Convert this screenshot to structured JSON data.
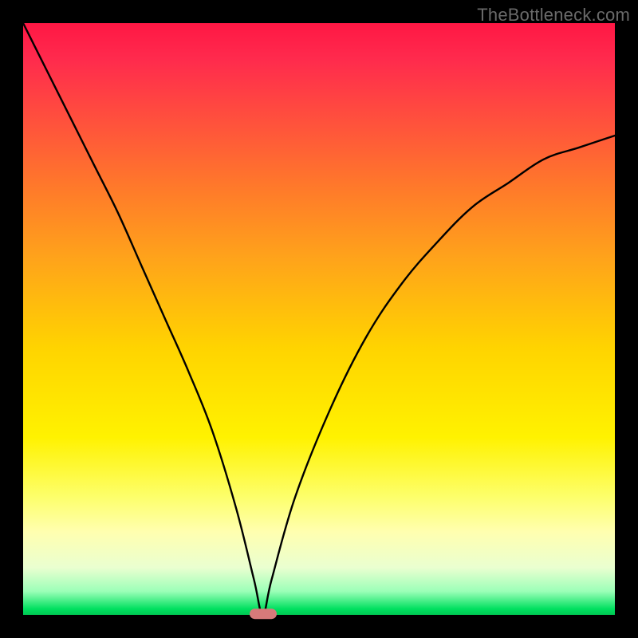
{
  "watermark": {
    "text": "TheBottleneck.com"
  },
  "chart_data": {
    "type": "line",
    "title": "",
    "xlabel": "",
    "ylabel": "",
    "xlim": [
      0,
      100
    ],
    "ylim": [
      0,
      100
    ],
    "optimum_x": 40.5,
    "marker": {
      "x": 40.5,
      "color": "#d77a7a"
    },
    "background_gradient": [
      {
        "stop": 0,
        "color": "#ff1744"
      },
      {
        "stop": 15,
        "color": "#ff4b3f"
      },
      {
        "stop": 40,
        "color": "#ffa41a"
      },
      {
        "stop": 70,
        "color": "#fff200"
      },
      {
        "stop": 92,
        "color": "#eaffd0"
      },
      {
        "stop": 100,
        "color": "#00c853"
      }
    ],
    "series": [
      {
        "name": "bottleneck-curve",
        "x": [
          0,
          4,
          8,
          12,
          16,
          20,
          24,
          28,
          32,
          36,
          39,
          40.5,
          42,
          46,
          52,
          58,
          64,
          70,
          76,
          82,
          88,
          94,
          100
        ],
        "y": [
          100,
          92,
          84,
          76,
          68,
          59,
          50,
          41,
          31,
          18,
          6,
          0,
          6,
          20,
          35,
          47,
          56,
          63,
          69,
          73,
          77,
          79,
          81
        ]
      }
    ]
  }
}
